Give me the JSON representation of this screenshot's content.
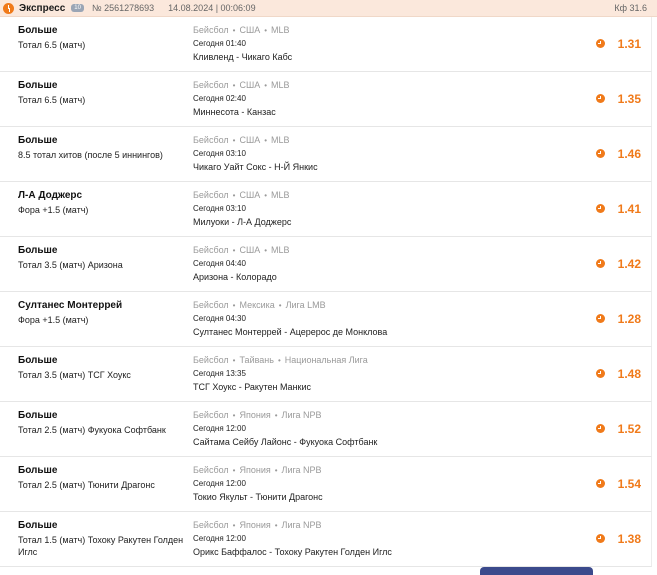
{
  "header": {
    "title": "Экспресс",
    "badge": "10",
    "number": "№ 2561278693",
    "datetime": "14.08.2024 | 00:06:09",
    "coef": "Кф 31.6"
  },
  "bets": [
    {
      "pick": "Больше",
      "market": "Тотал 6.5 (матч)",
      "sport": "Бейсбол",
      "country": "США",
      "league": "MLB",
      "time": "Сегодня 01:40",
      "teams": "Кливленд - Чикаго Кабс",
      "odds": "1.31"
    },
    {
      "pick": "Больше",
      "market": "Тотал 6.5 (матч)",
      "sport": "Бейсбол",
      "country": "США",
      "league": "MLB",
      "time": "Сегодня 02:40",
      "teams": "Миннесота - Канзас",
      "odds": "1.35"
    },
    {
      "pick": "Больше",
      "market": "8.5 тотал хитов (после 5 иннингов)",
      "sport": "Бейсбол",
      "country": "США",
      "league": "MLB",
      "time": "Сегодня 03:10",
      "teams": "Чикаго Уайт Сокс - Н-Й Янкис",
      "odds": "1.46"
    },
    {
      "pick": "Л-А Доджерс",
      "market": "Фора +1.5 (матч)",
      "sport": "Бейсбол",
      "country": "США",
      "league": "MLB",
      "time": "Сегодня 03:10",
      "teams": "Милуоки - Л-А Доджерс",
      "odds": "1.41"
    },
    {
      "pick": "Больше",
      "market": "Тотал 3.5 (матч) Аризона",
      "sport": "Бейсбол",
      "country": "США",
      "league": "MLB",
      "time": "Сегодня 04:40",
      "teams": "Аризона - Колорадо",
      "odds": "1.42"
    },
    {
      "pick": "Султанес Монтеррей",
      "market": "Фора +1.5 (матч)",
      "sport": "Бейсбол",
      "country": "Мексика",
      "league": "Лига LMB",
      "time": "Сегодня 04:30",
      "teams": "Султанес Монтеррей - Ацерерос де Монклова",
      "odds": "1.28"
    },
    {
      "pick": "Больше",
      "market": "Тотал 3.5 (матч) ТСГ Хоукс",
      "sport": "Бейсбол",
      "country": "Тайвань",
      "league": "Национальная Лига",
      "time": "Сегодня 13:35",
      "teams": "ТСГ Хоукс - Ракутен Манкис",
      "odds": "1.48"
    },
    {
      "pick": "Больше",
      "market": "Тотал 2.5 (матч) Фукуока Софтбанк",
      "sport": "Бейсбол",
      "country": "Япония",
      "league": "Лига NPB",
      "time": "Сегодня 12:00",
      "teams": "Сайтама Сейбу Лайонс - Фукуока Софтбанк",
      "odds": "1.52"
    },
    {
      "pick": "Больше",
      "market": "Тотал 2.5 (матч) Тюнити Драгонс",
      "sport": "Бейсбол",
      "country": "Япония",
      "league": "Лига NPB",
      "time": "Сегодня 12:00",
      "teams": "Токио Якульт - Тюнити Драгонс",
      "odds": "1.54"
    },
    {
      "pick": "Больше",
      "market": "Тотал 1.5 (матч) Тохоку Ракутен Голден Иглс",
      "sport": "Бейсбол",
      "country": "Япония",
      "league": "Лига NPB",
      "time": "Сегодня 12:00",
      "teams": "Орикс Баффалос - Тохоку Ракутен Голден Иглс",
      "odds": "1.38"
    }
  ],
  "colors": {
    "accent": "#f07a1a",
    "header_bg": "#fbe8dc",
    "bottom_button": "#3b4a8c"
  },
  "icons": {
    "header": "bookmaker-logo-icon",
    "row": "clock-icon"
  }
}
